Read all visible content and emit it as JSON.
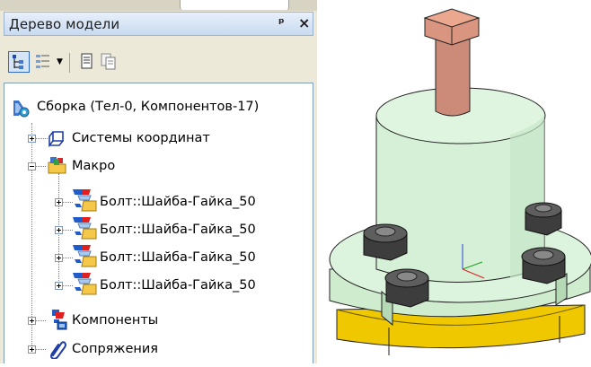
{
  "panel": {
    "title": "Дерево модели",
    "pin_glyph": "ᵖ",
    "close_glyph": "×"
  },
  "toolbar": {
    "buttons": [
      {
        "name": "tree-structure-icon",
        "active": true
      },
      {
        "name": "view-options-icon",
        "dropdown": true
      },
      {
        "name": "document-icon"
      },
      {
        "name": "copy-document-icon"
      }
    ]
  },
  "tree": {
    "root": {
      "label": "Сборка (Тел-0, Компонентов-17)",
      "icon": "assembly-icon"
    },
    "items": [
      {
        "label": "Системы координат",
        "icon": "coordinate-system-icon",
        "expander": "plus"
      },
      {
        "label": "Макро",
        "icon": "macro-folder-icon",
        "expander": "minus"
      },
      {
        "label": "Болт::Шайба-Гайка_50",
        "icon": "bolt-component-icon",
        "expander": "plus"
      },
      {
        "label": "Болт::Шайба-Гайка_50",
        "icon": "bolt-component-icon",
        "expander": "plus"
      },
      {
        "label": "Болт::Шайба-Гайка_50",
        "icon": "bolt-component-icon",
        "expander": "plus"
      },
      {
        "label": "Болт::Шайба-Гайка_50",
        "icon": "bolt-component-icon",
        "expander": "plus"
      },
      {
        "label": "Компоненты",
        "icon": "components-icon",
        "expander": "plus"
      },
      {
        "label": "Сопряжения",
        "icon": "paperclip-icon",
        "expander": "plus"
      }
    ]
  },
  "colors": {
    "body_green": "#d8f2da",
    "flange_green": "#d4efd3",
    "base_yellow": "#f0c800",
    "shaft_rose": "#cf8f7d",
    "bolt_dark": "#3c3c3c"
  }
}
